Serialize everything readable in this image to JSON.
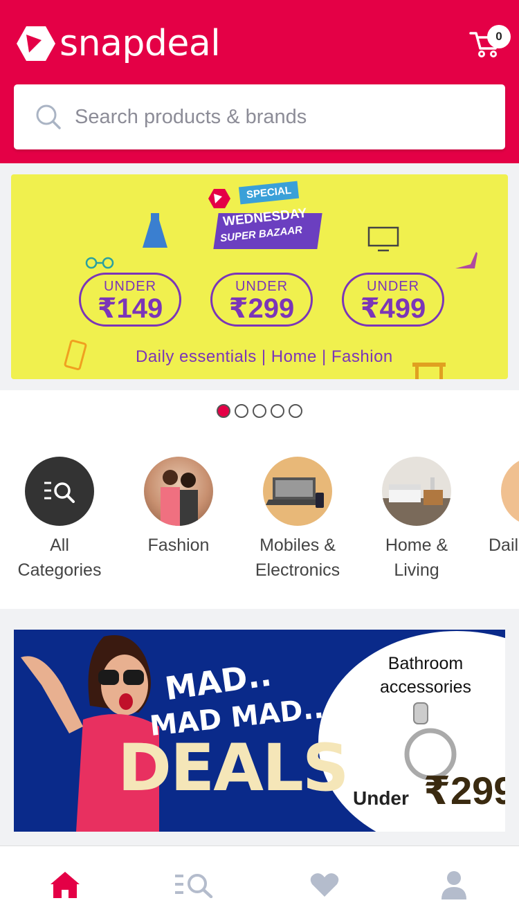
{
  "header": {
    "brand": "snapdeal",
    "cart_count": "0"
  },
  "search": {
    "placeholder": "Search products & brands"
  },
  "carousel": {
    "banner": {
      "tag": "SPECIAL",
      "title": "WEDNESDAY",
      "subtitle": "SUPER BAZAAR",
      "offers": [
        {
          "label": "UNDER",
          "price": "₹149"
        },
        {
          "label": "UNDER",
          "price": "₹299"
        },
        {
          "label": "UNDER",
          "price": "₹499"
        }
      ],
      "tagline": "Daily essentials | Home | Fashion"
    },
    "slide_count": 5,
    "active_slide": 1
  },
  "categories": [
    {
      "line1": "All",
      "line2": "Categories",
      "icon": "all-categories-icon"
    },
    {
      "line1": "Fashion",
      "line2": "",
      "icon": "fashion-image"
    },
    {
      "line1": "Mobiles &",
      "line2": "Electronics",
      "icon": "electronics-image"
    },
    {
      "line1": "Home &",
      "line2": "Living",
      "icon": "home-image"
    },
    {
      "line1": "Dail",
      "line2": "",
      "icon": "daily-image"
    }
  ],
  "deals_banner": {
    "mad1": "MAD..",
    "mad2": "MAD MAD..",
    "big": "DEALS",
    "product_title": "Bathroom accessories",
    "under_label": "Under",
    "price": "₹299"
  },
  "bottom_nav": [
    {
      "name": "home",
      "icon": "home-icon",
      "active": true
    },
    {
      "name": "categories",
      "icon": "categories-icon",
      "active": false
    },
    {
      "name": "wishlist",
      "icon": "heart-icon",
      "active": false
    },
    {
      "name": "account",
      "icon": "user-icon",
      "active": false
    }
  ],
  "colors": {
    "brand": "#e40046",
    "banner_yellow": "#f0f04e",
    "purple": "#7b35b8",
    "deals_blue": "#0a2a8a",
    "nav_inactive": "#b4bccc"
  }
}
